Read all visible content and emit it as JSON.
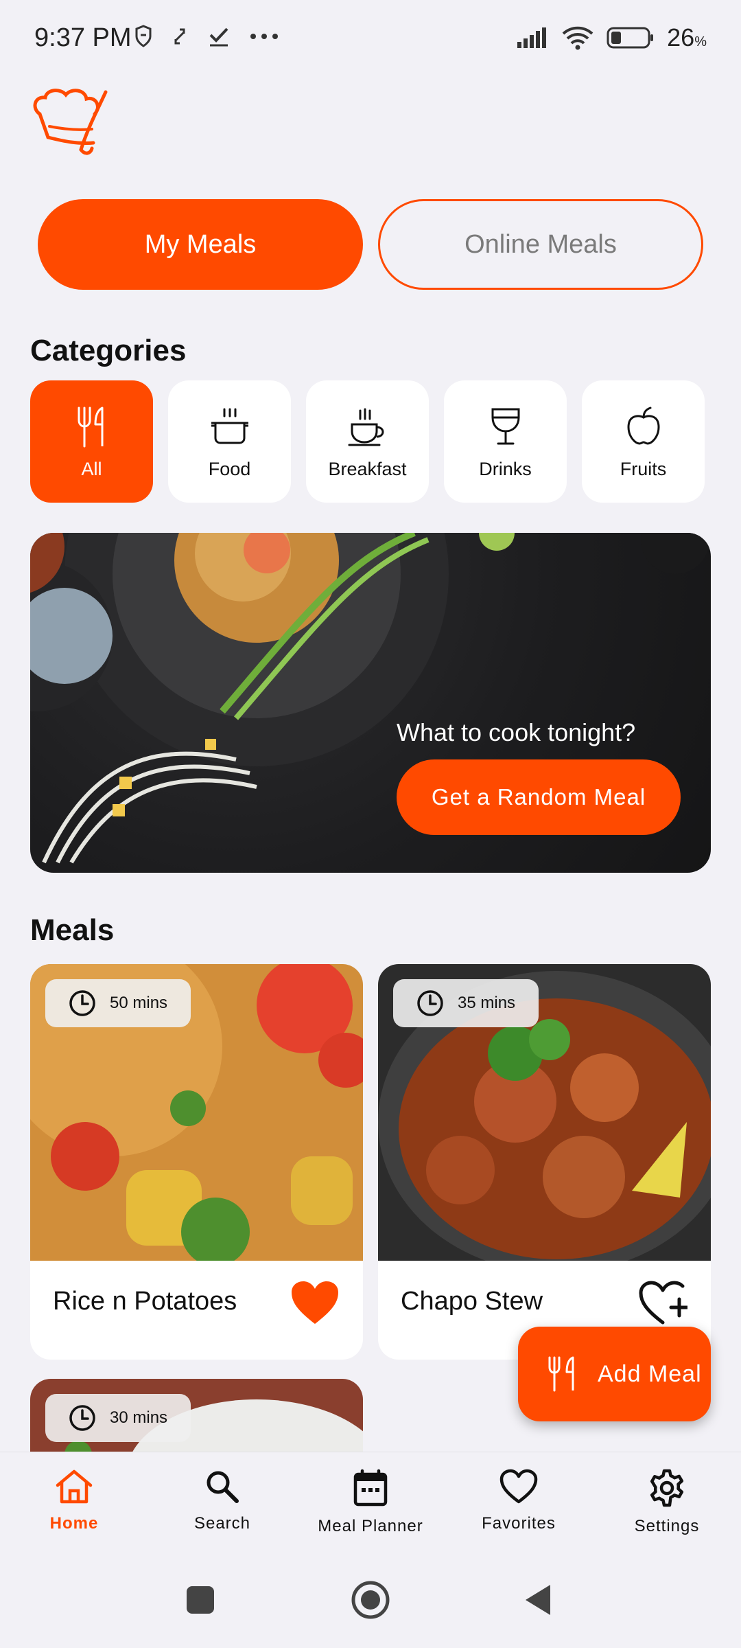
{
  "status_bar": {
    "time": "9:37 PM",
    "battery": "26",
    "battery_unit": "%"
  },
  "toggle": {
    "my_meals": "My Meals",
    "online_meals": "Online Meals"
  },
  "categories_title": "Categories",
  "categories": [
    {
      "label": "All",
      "icon": "fork-knife-icon"
    },
    {
      "label": "Food",
      "icon": "pot-icon"
    },
    {
      "label": "Breakfast",
      "icon": "cup-icon"
    },
    {
      "label": "Drinks",
      "icon": "wine-glass-icon"
    },
    {
      "label": "Fruits",
      "icon": "apple-icon"
    }
  ],
  "hero": {
    "question": "What to cook tonight?",
    "button": "Get a Random Meal"
  },
  "meals_title": "Meals",
  "meals": [
    {
      "name": "Rice n Potatoes",
      "time": "50 mins",
      "favorite": true
    },
    {
      "name": "Chapo Stew",
      "time": "35 mins",
      "favorite": false
    },
    {
      "name": "",
      "time": "30 mins",
      "favorite": false
    }
  ],
  "fab": {
    "label": "Add Meal"
  },
  "bottom_nav": [
    {
      "label": "Home",
      "icon": "home-icon"
    },
    {
      "label": "Search",
      "icon": "search-icon"
    },
    {
      "label": "Meal Planner",
      "icon": "calendar-icon"
    },
    {
      "label": "Favorites",
      "icon": "heart-icon"
    },
    {
      "label": "Settings",
      "icon": "gear-icon"
    }
  ],
  "colors": {
    "accent": "#ff4a00",
    "background": "#f2f1f6"
  }
}
